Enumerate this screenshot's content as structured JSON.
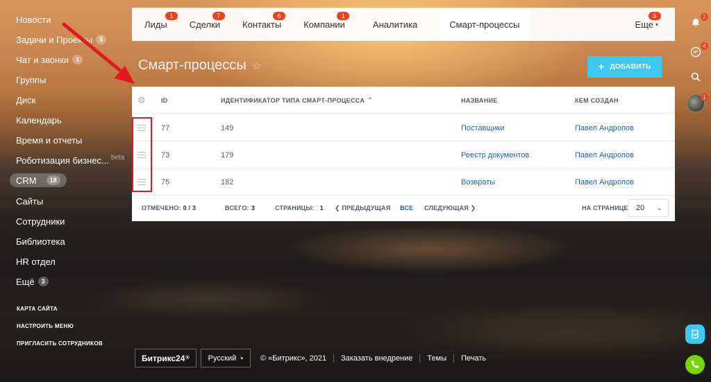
{
  "sidebar": {
    "items": [
      {
        "label": "Новости",
        "count": ""
      },
      {
        "label": "Задачи и Проекты",
        "count": "5"
      },
      {
        "label": "Чат и звонки",
        "count": "1"
      },
      {
        "label": "Группы",
        "count": ""
      },
      {
        "label": "Диск",
        "count": ""
      },
      {
        "label": "Календарь",
        "count": ""
      },
      {
        "label": "Время и отчеты",
        "count": ""
      },
      {
        "label": "Роботизация бизнес...",
        "count": "",
        "beta": "beta"
      },
      {
        "label": "CRM",
        "count": "18"
      },
      {
        "label": "Сайты",
        "count": ""
      },
      {
        "label": "Сотрудники",
        "count": ""
      },
      {
        "label": "Библиотека",
        "count": ""
      },
      {
        "label": "HR отдел",
        "count": ""
      },
      {
        "label": "Ещё",
        "count": "3"
      }
    ],
    "footer": [
      "КАРТА САЙТА",
      "НАСТРОИТЬ МЕНЮ",
      "ПРИГЛАСИТЬ СОТРУДНИКОВ"
    ]
  },
  "tabs": [
    {
      "label": "Лиды",
      "badge": "1"
    },
    {
      "label": "Сделки",
      "badge": "7"
    },
    {
      "label": "Контакты",
      "badge": "6"
    },
    {
      "label": "Компании",
      "badge": "1"
    },
    {
      "label": "Аналитика",
      "badge": ""
    },
    {
      "label": "Смарт-процессы",
      "badge": ""
    }
  ],
  "tab_more": {
    "label": "Еще",
    "badge": "3",
    "caret": "▾"
  },
  "page": {
    "title": "Смарт-процессы",
    "star": "☆",
    "add_label": "ДОБАВИТЬ",
    "add_plus": "+"
  },
  "grid": {
    "columns": {
      "id": "ID",
      "type_id": "ИДЕНТИФИКАТОР ТИПА СМАРТ-ПРОЦЕССА",
      "sort": "⌃",
      "name": "НАЗВАНИЕ",
      "created_by": "КЕМ СОЗДАН"
    },
    "rows": [
      {
        "id": "77",
        "type_id": "149",
        "name": "Поставщики",
        "created_by": "Павел Андропов"
      },
      {
        "id": "73",
        "type_id": "179",
        "name": "Реестр документов",
        "created_by": "Павел Андропов"
      },
      {
        "id": "75",
        "type_id": "182",
        "name": "Возвраты",
        "created_by": "Павел Андропов"
      }
    ],
    "footer": {
      "marked_label": "ОТМЕЧЕНО:",
      "marked_value": "0 / 3",
      "total_label": "ВСЕГО:",
      "total_value": "3",
      "pages_label": "СТРАНИЦЫ:",
      "pages_value": "1",
      "prev": "❮ ПРЕДЫДУЩАЯ",
      "all": "ВСЕ",
      "next": "СЛЕДУЮЩАЯ ❯",
      "per_page_label": "НА СТРАНИЦЕ:",
      "per_page_value": "20"
    }
  },
  "right_panel": {
    "notify_badge": "2",
    "chat_badge": "4",
    "avatar_badge": "1"
  },
  "footer": {
    "brand": "Битрикс24",
    "brand_mark": "®",
    "language": "Русский",
    "lang_caret": "▾",
    "copyright": "© «Битрикс», 2021",
    "links": [
      "Заказать внедрение",
      "Темы",
      "Печать"
    ]
  },
  "colors": {
    "accent": "#3bc8f5",
    "badge": "#f0411e",
    "link": "#2067b0",
    "annotation": "#e3191f"
  }
}
